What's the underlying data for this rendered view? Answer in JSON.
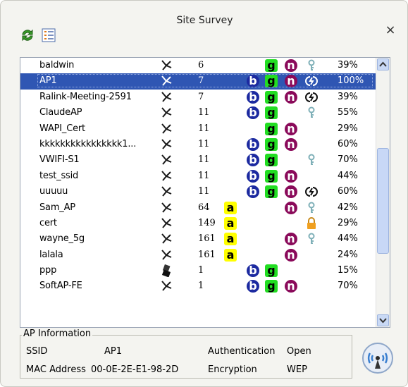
{
  "window": {
    "title": "Site Survey",
    "close_glyph": "×"
  },
  "toolbar": {
    "refresh_icon": "refresh-icon",
    "list_icon": "list-view-icon"
  },
  "networks": [
    {
      "ssid": "baldwin",
      "channel": "6",
      "a": false,
      "b": false,
      "g": true,
      "n": true,
      "security": "key",
      "signal": "39%"
    },
    {
      "ssid": "AP1",
      "channel": "7",
      "a": false,
      "b": true,
      "g": true,
      "n": true,
      "security": "wep",
      "signal": "100%",
      "selected": true
    },
    {
      "ssid": "Ralink-Meeting-2591",
      "channel": "7",
      "a": false,
      "b": true,
      "g": true,
      "n": true,
      "security": "wep",
      "signal": "39%"
    },
    {
      "ssid": "ClaudeAP",
      "channel": "11",
      "a": false,
      "b": true,
      "g": true,
      "n": false,
      "security": "key",
      "signal": "55%"
    },
    {
      "ssid": "WAPI_Cert",
      "channel": "11",
      "a": false,
      "b": false,
      "g": true,
      "n": true,
      "security": "",
      "signal": "29%"
    },
    {
      "ssid": "kkkkkkkkkkkkkkkk1...",
      "channel": "11",
      "a": false,
      "b": true,
      "g": true,
      "n": true,
      "security": "",
      "signal": "60%"
    },
    {
      "ssid": "VWIFI-S1",
      "channel": "11",
      "a": false,
      "b": true,
      "g": true,
      "n": false,
      "security": "key",
      "signal": "70%"
    },
    {
      "ssid": "test_ssid",
      "channel": "11",
      "a": false,
      "b": true,
      "g": true,
      "n": true,
      "security": "",
      "signal": "44%"
    },
    {
      "ssid": "uuuuu",
      "channel": "11",
      "a": false,
      "b": true,
      "g": true,
      "n": true,
      "security": "wep",
      "signal": "60%"
    },
    {
      "ssid": "Sam_AP",
      "channel": "64",
      "a": true,
      "b": false,
      "g": false,
      "n": true,
      "security": "key",
      "signal": "42%"
    },
    {
      "ssid": "cert",
      "channel": "149",
      "a": true,
      "b": false,
      "g": false,
      "n": false,
      "security": "lock",
      "signal": "29%"
    },
    {
      "ssid": "wayne_5g",
      "channel": "161",
      "a": true,
      "b": false,
      "g": false,
      "n": true,
      "security": "key",
      "signal": "44%"
    },
    {
      "ssid": "lalala",
      "channel": "161",
      "a": true,
      "b": false,
      "g": false,
      "n": true,
      "security": "",
      "signal": "24%"
    },
    {
      "ssid": "ppp",
      "channel": "1",
      "a": false,
      "b": true,
      "g": true,
      "n": false,
      "security": "",
      "signal": "15%",
      "device": "usb-adapter-icon"
    },
    {
      "ssid": "SoftAP-FE",
      "channel": "1",
      "a": false,
      "b": true,
      "g": true,
      "n": true,
      "security": "",
      "signal": "70%"
    }
  ],
  "badge_letters": {
    "a": "a",
    "b": "b",
    "g": "g",
    "n": "n"
  },
  "ap_info": {
    "legend": "AP Information",
    "ssid_label": "SSID",
    "ssid_value": "AP1",
    "mac_label": "MAC Address",
    "mac_value": "00-0E-2E-E1-98-2D",
    "auth_label": "Authentication",
    "auth_value": "Open",
    "enc_label": "Encryption",
    "enc_value": "WEP"
  },
  "colors": {
    "selected_row": "#2f56b3",
    "badge_a": "#ffff00",
    "badge_b": "#1c2aa0",
    "badge_g": "#22dd22",
    "badge_n": "#8a0a5a"
  }
}
